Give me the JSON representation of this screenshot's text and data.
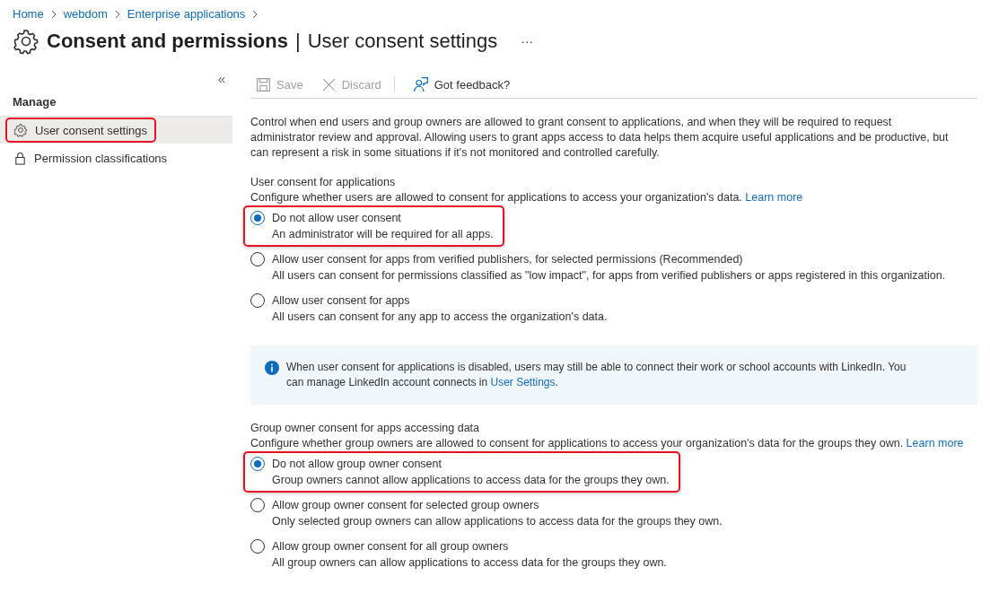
{
  "breadcrumb": [
    {
      "label": "Home"
    },
    {
      "label": "webdom"
    },
    {
      "label": "Enterprise applications"
    }
  ],
  "title": {
    "main": "Consent and permissions",
    "separator": "|",
    "sub": "User consent settings",
    "more": "···"
  },
  "sidebar": {
    "collapse": "«",
    "section": "Manage",
    "items": [
      {
        "label": "User consent settings",
        "kind": "gear",
        "selected": true,
        "highlighted": true
      },
      {
        "label": "Permission classifications",
        "kind": "lock",
        "selected": false,
        "highlighted": false
      }
    ]
  },
  "toolbar": [
    {
      "label": "Save",
      "kind": "save",
      "disabled": true
    },
    {
      "label": "Discard",
      "kind": "discard",
      "disabled": true
    },
    {
      "label": "Got feedback?",
      "kind": "feedback",
      "disabled": false
    }
  ],
  "intro": "Control when end users and group owners are allowed to grant consent to applications, and when they will be required to request administrator review and approval. Allowing users to grant apps access to data helps them acquire useful applications and be productive, but can represent a risk in some situations if it's not monitored and controlled carefully.",
  "sections": [
    {
      "heading": "User consent for applications",
      "description": "Configure whether users are allowed to consent for applications to access your organization's data.",
      "link": "Learn more",
      "options": [
        {
          "label": "Do not allow user consent",
          "detail": "An administrator will be required for all apps.",
          "selected": true,
          "highlighted": true
        },
        {
          "label": "Allow user consent for apps from verified publishers, for selected permissions (Recommended)",
          "detail": "All users can consent for permissions classified as \"low impact\", for apps from verified publishers or apps registered in this organization.",
          "selected": false,
          "highlighted": false
        },
        {
          "label": "Allow user consent for apps",
          "detail": "All users can consent for any app to access the organization's data.",
          "selected": false,
          "highlighted": false
        }
      ],
      "info": {
        "text": "When user consent for applications is disabled, users may still be able to connect their work or school accounts with LinkedIn. You can manage LinkedIn account connects in",
        "link": "User Settings",
        "end": "."
      }
    },
    {
      "heading": "Group owner consent for apps accessing data",
      "description": "Configure whether group owners are allowed to consent for applications to access your organization's data for the groups they own.",
      "link": "Learn more",
      "options": [
        {
          "label": "Do not allow group owner consent",
          "detail": "Group owners cannot allow applications to access data for the groups they own.",
          "selected": true,
          "highlighted": true
        },
        {
          "label": "Allow group owner consent for selected group owners",
          "detail": "Only selected group owners can allow applications to access data for the groups they own.",
          "selected": false,
          "highlighted": false
        },
        {
          "label": "Allow group owner consent for all group owners",
          "detail": "All group owners can allow applications to access data for the groups they own.",
          "selected": false,
          "highlighted": false
        }
      ]
    }
  ]
}
